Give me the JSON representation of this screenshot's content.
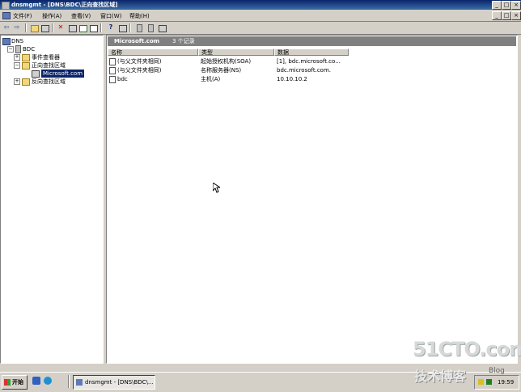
{
  "window": {
    "title": "dnsmgmt - [DNS\\BDC\\正向查找区域]",
    "minimize_glyph": "_",
    "maximize_glyph": "□",
    "close_glyph": "×"
  },
  "menu": {
    "items": [
      {
        "label": "文件(F)"
      },
      {
        "label": "操作(A)"
      },
      {
        "label": "查看(V)"
      },
      {
        "label": "窗口(W)"
      },
      {
        "label": "帮助(H)"
      }
    ]
  },
  "toolbar": {
    "icons": [
      "back-icon",
      "forward-icon",
      "up-folder-icon",
      "show-tree-icon",
      "delete-icon",
      "properties-icon",
      "refresh-icon",
      "export-icon",
      "help-icon",
      "console-icon",
      "server-icon",
      "server2-icon",
      "record-icon"
    ],
    "glyphs": {
      "back": "⇦",
      "forward": "⇨",
      "delete": "✕",
      "help": "?"
    }
  },
  "tree": {
    "root": "DNS",
    "server": "BDC",
    "items": [
      {
        "label": "事件查看器",
        "expander": "+"
      },
      {
        "label": "正向查找区域",
        "expander": "−"
      },
      {
        "label": "Microsoft.com",
        "selected": true
      },
      {
        "label": "反向查找区域",
        "expander": "+"
      }
    ]
  },
  "pane_header": {
    "zone": "Microsoft.com",
    "count": "3 个记录"
  },
  "list": {
    "columns": [
      "名称",
      "类型",
      "数据"
    ],
    "rows": [
      {
        "name": "(与父文件夹相同)",
        "type": "起始授权机构(SOA)",
        "data": "[1], bdc.microsoft.co..."
      },
      {
        "name": "(与父文件夹相同)",
        "type": "名称服务器(NS)",
        "data": "bdc.microsoft.com."
      },
      {
        "name": "bdc",
        "type": "主机(A)",
        "data": "10.10.10.2"
      }
    ]
  },
  "taskbar": {
    "start_label": "开始",
    "task_label": "dnsmgmt - [DNS\\BDC\\...",
    "clock": "19:59"
  },
  "watermark": {
    "main": "51CTO.com",
    "sub": "技术博客",
    "blog": "Blog"
  }
}
